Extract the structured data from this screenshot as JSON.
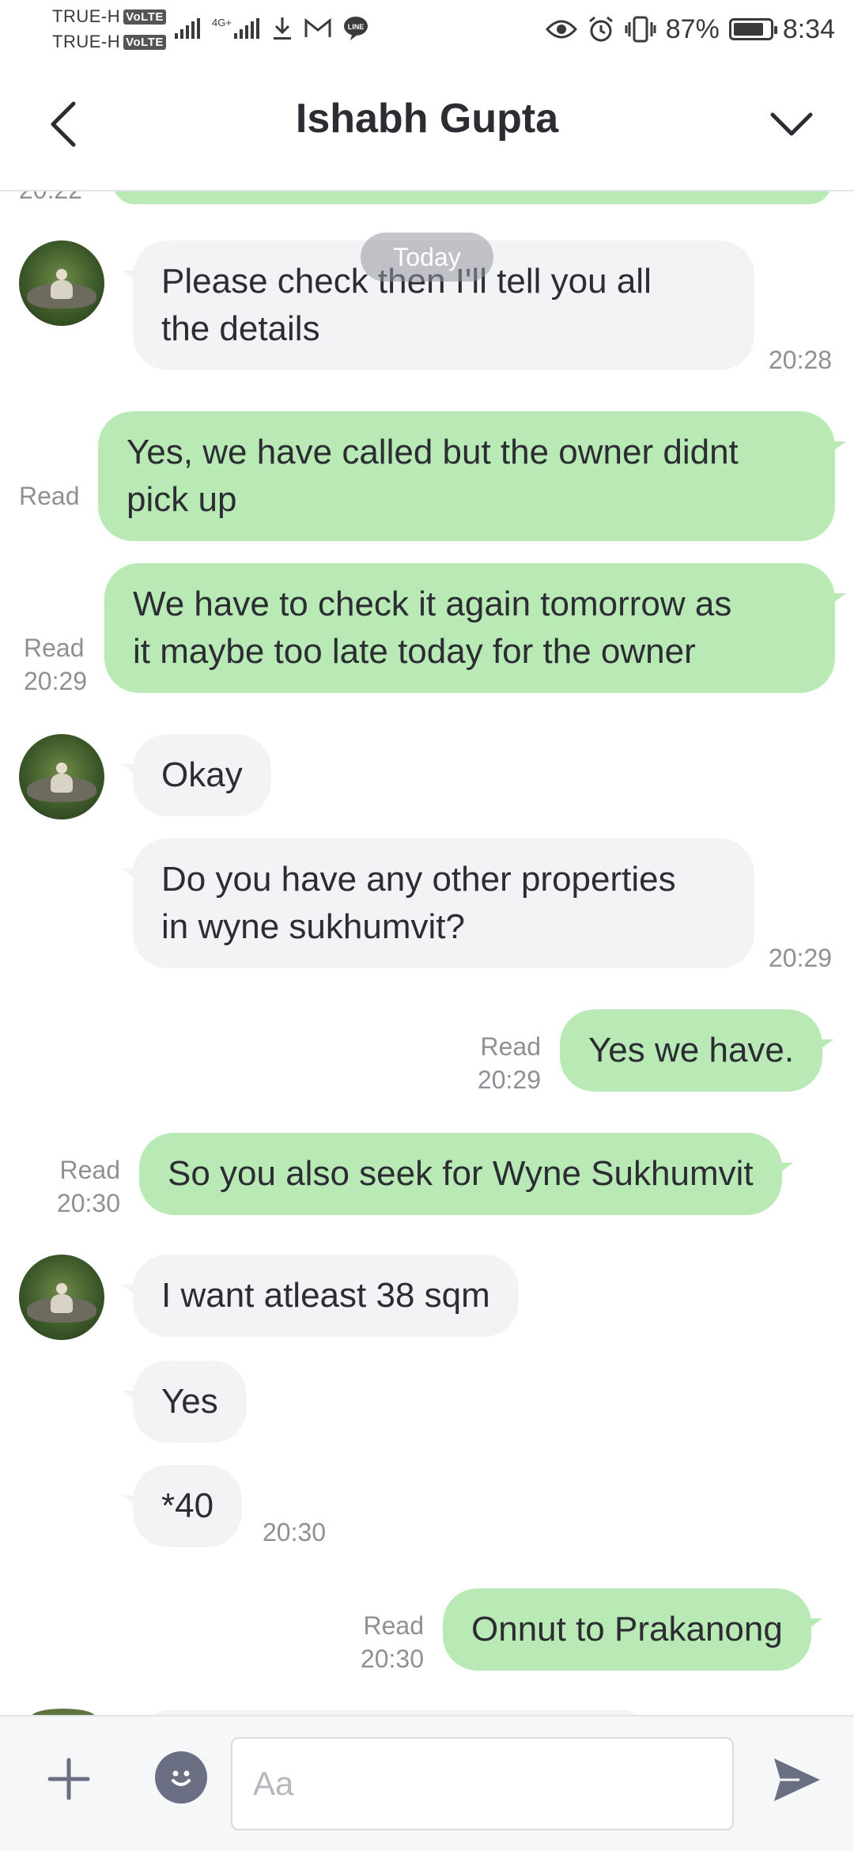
{
  "status_bar": {
    "carrier_1": "TRUE-H",
    "carrier_2": "TRUE-H",
    "volte_badge": "VoLTE",
    "network_label": "4G+",
    "battery": "87%",
    "time": "8:34",
    "icons_left": [
      "signal-icon",
      "signal-4g-icon",
      "download-icon",
      "gmail-icon",
      "line-icon"
    ],
    "icons_right": [
      "eye-icon",
      "alarm-icon",
      "vibrate-icon"
    ]
  },
  "header": {
    "title": "Ishabh Gupta"
  },
  "chat": {
    "partial_time": "20:22",
    "date_label": "Today",
    "messages": [
      {
        "dir": "in",
        "text_l1": "Please check then I'll tell you all",
        "text_l2": "the details",
        "time": "20:28"
      },
      {
        "dir": "out",
        "text_l1": "Yes, we have called but the owner didnt",
        "text_l2": "pick up",
        "read": "Read"
      },
      {
        "dir": "out",
        "text_l1": "We have to check it again tomorrow as",
        "text_l2": "it maybe too late today for the owner",
        "read": "Read",
        "time": "20:29"
      },
      {
        "dir": "in",
        "text": "Okay"
      },
      {
        "dir": "in",
        "text_l1": "Do you have any other properties",
        "text_l2": "in wyne sukhumvit?",
        "time": "20:29"
      },
      {
        "dir": "out",
        "text": "Yes we have.",
        "read": "Read",
        "time": "20:29"
      },
      {
        "dir": "out",
        "text": "So you also seek for Wyne Sukhumvit",
        "read": "Read",
        "time": "20:30"
      },
      {
        "dir": "in",
        "text": "I want atleast 38 sqm"
      },
      {
        "dir": "in",
        "text": "Yes"
      },
      {
        "dir": "in",
        "text": "*40",
        "time": "20:30"
      },
      {
        "dir": "out",
        "text": "Onnut to Prakanong",
        "read": "Read",
        "time": "20:30"
      }
    ]
  },
  "input_bar": {
    "placeholder": "Aa"
  },
  "colors": {
    "outgoing_bubble": "#b9eab6",
    "incoming_bubble": "#f2f3f5",
    "meta_text": "#8e9096",
    "icon_tint": "#6b6f83"
  }
}
